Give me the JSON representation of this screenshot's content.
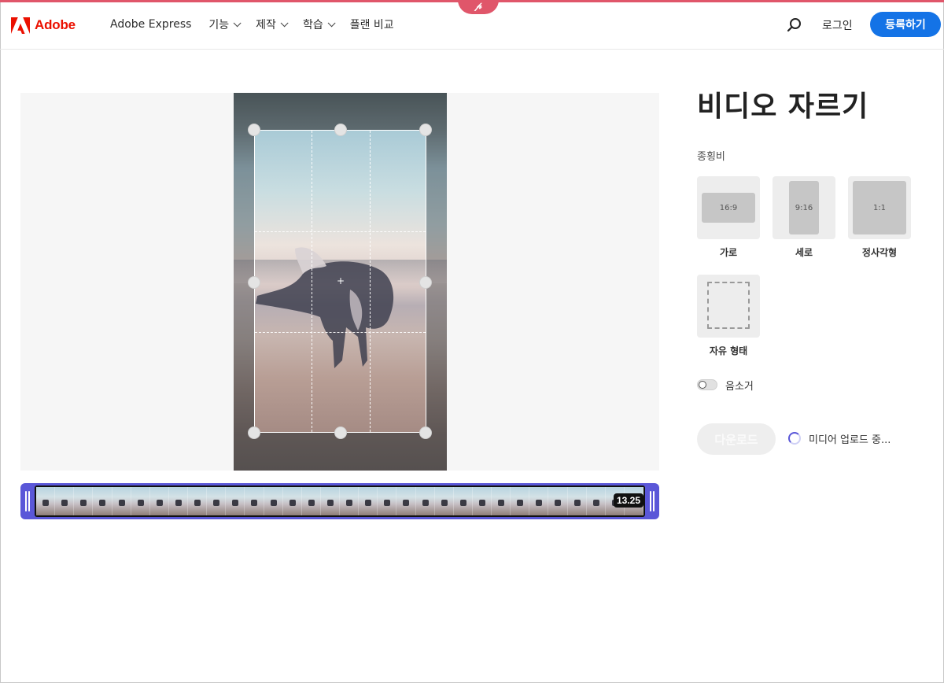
{
  "header": {
    "brand": "Adobe",
    "badge_glyph": "𝓅",
    "nav": [
      {
        "label": "Adobe Express",
        "has_dropdown": false
      },
      {
        "label": "기능",
        "has_dropdown": true
      },
      {
        "label": "제작",
        "has_dropdown": true
      },
      {
        "label": "학습",
        "has_dropdown": true
      },
      {
        "label": "플랜 비교",
        "has_dropdown": false
      }
    ],
    "login_label": "로그인",
    "signup_label": "등록하기",
    "icons": {
      "logo": "adobe-logo-icon",
      "search": "search-icon",
      "chevron": "chevron-down-icon"
    }
  },
  "editor": {
    "duration": "13.25",
    "icons": {
      "crop_center": "crosshair-icon",
      "trim_handle": "grip-handle-icon"
    }
  },
  "panel": {
    "title": "비디오 자르기",
    "aspect_label": "종횡비",
    "ratios": [
      {
        "label": "가로",
        "ratio": "16:9"
      },
      {
        "label": "세로",
        "ratio": "9:16"
      },
      {
        "label": "정사각형",
        "ratio": "1:1"
      },
      {
        "label": "자유 형태",
        "ratio": ""
      }
    ],
    "mute_label": "음소거",
    "mute_on": false,
    "download_label": "다운로드",
    "upload_status": "미디어 업로드 중..."
  },
  "colors": {
    "accent_top": "#e0566a",
    "brand_red": "#eb1000",
    "primary_blue": "#1473e6",
    "timeline_purple": "#5a57d8"
  }
}
